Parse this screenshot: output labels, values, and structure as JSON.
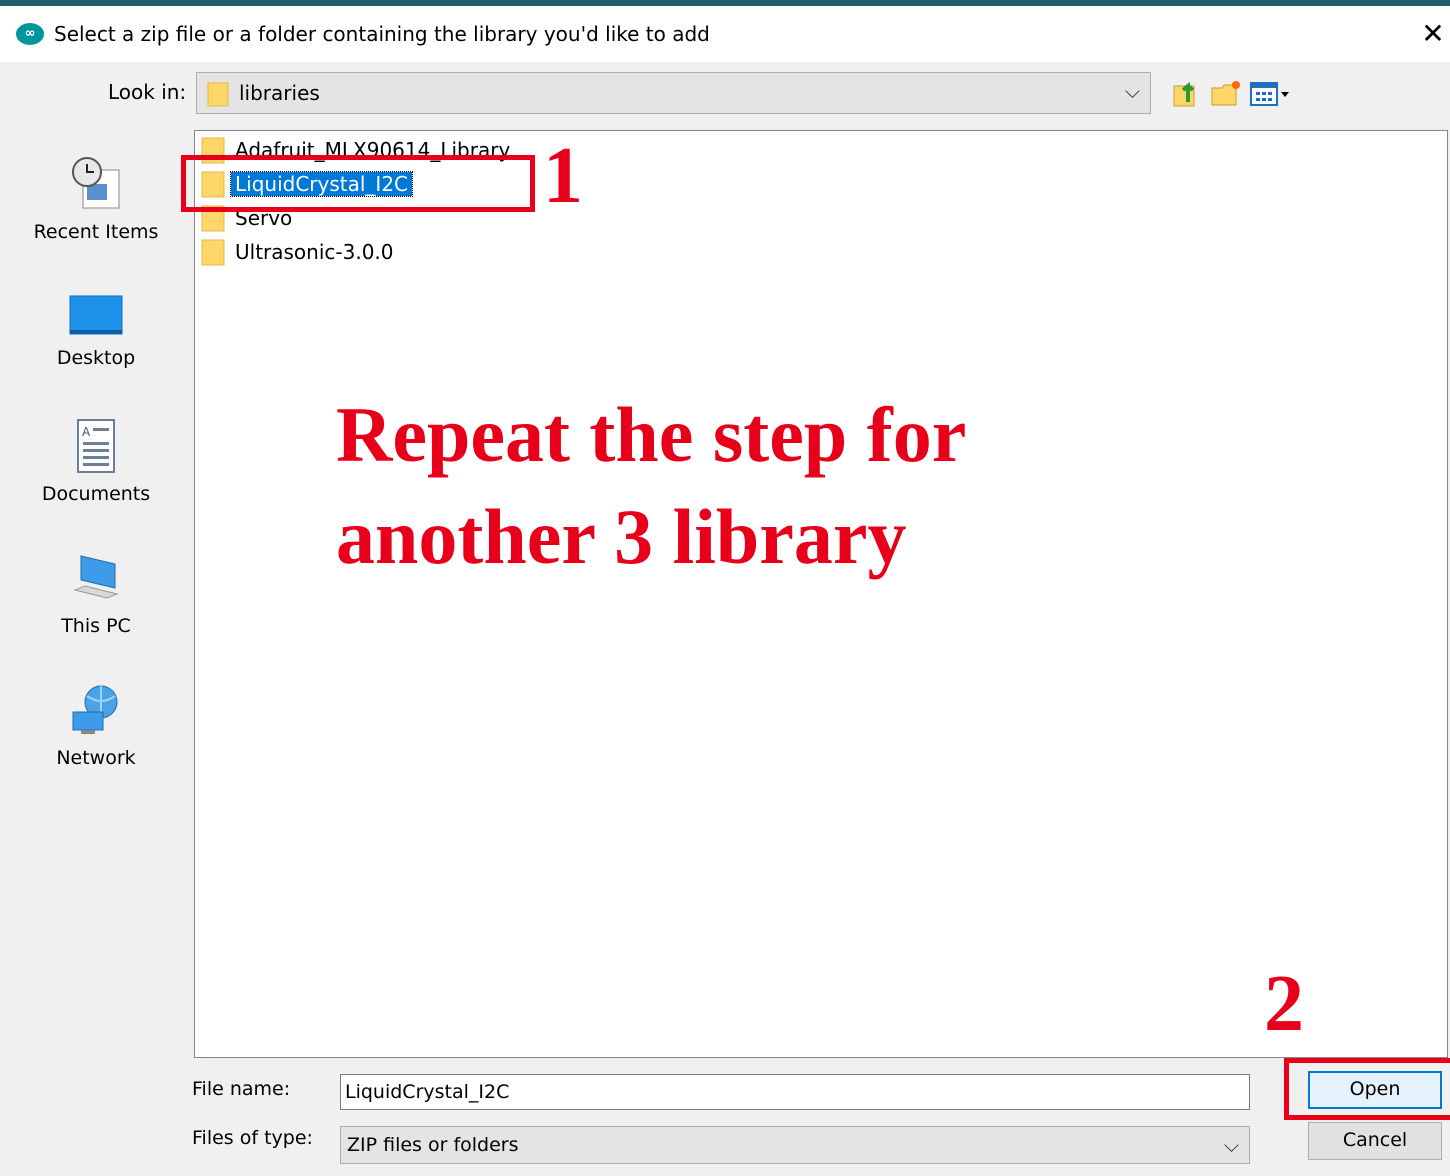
{
  "window": {
    "title": "Select a zip file or a folder containing the library you'd like to add",
    "app_icon": "∞",
    "close_glyph": "✕"
  },
  "toolbar": {
    "look_in_label": "Look in:",
    "look_in_value": "libraries",
    "dropdown_glyph": "⌵"
  },
  "places": [
    {
      "label": "Recent Items",
      "icon": "recent-items-icon"
    },
    {
      "label": "Desktop",
      "icon": "desktop-icon"
    },
    {
      "label": "Documents",
      "icon": "documents-icon"
    },
    {
      "label": "This PC",
      "icon": "this-pc-icon"
    },
    {
      "label": "Network",
      "icon": "network-icon"
    }
  ],
  "files": [
    {
      "name": "Adafruit_MLX90614_Library",
      "selected": false
    },
    {
      "name": "LiquidCrystal_I2C",
      "selected": true
    },
    {
      "name": "Servo",
      "selected": false
    },
    {
      "name": "Ultrasonic-3.0.0",
      "selected": false
    }
  ],
  "footer": {
    "file_name_label": "File name:",
    "file_name_value": "LiquidCrystal_I2C",
    "file_type_label": "Files of type:",
    "file_type_value": "ZIP files or folders",
    "open_label": "Open",
    "cancel_label": "Cancel"
  },
  "annotations": {
    "step1": "1",
    "step2": "2",
    "line1": "Repeat the step for",
    "line2": "another 3 library",
    "color": "#e8001a"
  },
  "colors": {
    "selection": "#0078d7",
    "accent_strip": "#1f5f6a",
    "app_icon": "#00979c"
  }
}
